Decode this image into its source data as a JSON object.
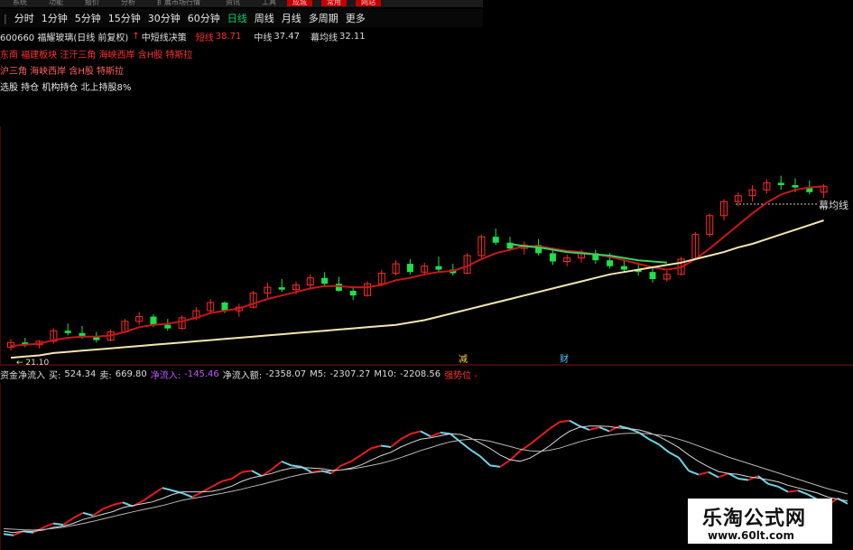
{
  "toolbar": {
    "menus": [
      "系统",
      "功能",
      "报价",
      "分析",
      "扩展市场行情",
      "资讯",
      "工具",
      "帮助"
    ],
    "red_menus": [
      "成城",
      "常用",
      "网站"
    ]
  },
  "periods": [
    "分时",
    "1分钟",
    "5分钟",
    "15分钟",
    "30分钟",
    "60分钟",
    "日线",
    "周线",
    "月线",
    "多周期",
    "更多"
  ],
  "active_period": "日线",
  "info": {
    "stock": "600660 福耀玻璃(日线 前复权)",
    "indicator": "中短线决策",
    "short_label": "短线",
    "short_value": "38.71",
    "mid_label": "中线",
    "mid_value": "37.47",
    "long_label": "幕均线",
    "long_value": "32.11"
  },
  "tags": {
    "line1": "东南 福建板块 汪汗三角 海峡西岸 含H股 特斯拉",
    "line2": "沪三角 海峡西岸 含H股 特斯拉",
    "line3": "选股 持仓 机构持仓 北上持股8%"
  },
  "ma_label": "幕均线",
  "markers": {
    "low_price": "21.10",
    "event1": "减",
    "event2": "财"
  },
  "volume_bar": {
    "title": "资金净流入",
    "buy_label": "买:",
    "buy_value": "524.34",
    "sell_label": "卖:",
    "sell_value": "669.80",
    "net_label": "净流入:",
    "net_value": "-145.46",
    "cum_label": "净流入额:",
    "cum_value": "-2358.07",
    "m5_label": "M5:",
    "m5_value": "-2307.27",
    "m10_label": "M10:",
    "m10_value": "-2208.56",
    "extra": "强势位 -"
  },
  "watermark": {
    "title": "乐淘公式网",
    "url": "www.60lt.com"
  },
  "colors": {
    "up": "#ff2a2a",
    "down": "#1fe04a",
    "flat_yellow": "#f0e060",
    "ma_short": "#c81818",
    "ma_mid": "#3ed060",
    "ma_long": "#f4e6b0",
    "flow_red": "#e81c1c",
    "flow_cyan": "#6fd4e8",
    "flow_white": "#d8d8d8"
  },
  "chart_data": [
    {
      "type": "candlestick",
      "title": "600660 福耀玻璃(日线 前复权)",
      "ylim": [
        20,
        40
      ],
      "candles": [
        [
          21.2,
          21.9,
          20.9,
          21.6
        ],
        [
          21.6,
          22.0,
          21.2,
          21.4
        ],
        [
          21.4,
          21.8,
          21.1,
          21.7
        ],
        [
          21.7,
          22.8,
          21.5,
          22.6
        ],
        [
          22.6,
          23.2,
          22.2,
          22.4
        ],
        [
          22.4,
          23.0,
          21.9,
          22.1
        ],
        [
          22.1,
          22.5,
          21.6,
          21.8
        ],
        [
          21.8,
          22.7,
          21.7,
          22.5
        ],
        [
          22.5,
          23.6,
          22.4,
          23.4
        ],
        [
          23.4,
          24.2,
          23.1,
          23.8
        ],
        [
          23.8,
          24.0,
          22.9,
          23.1
        ],
        [
          23.1,
          23.6,
          22.6,
          22.8
        ],
        [
          22.8,
          23.9,
          22.7,
          23.7
        ],
        [
          23.7,
          24.6,
          23.5,
          24.3
        ],
        [
          24.3,
          25.3,
          24.1,
          25.0
        ],
        [
          25.0,
          25.1,
          24.1,
          24.3
        ],
        [
          24.3,
          24.9,
          23.8,
          24.6
        ],
        [
          24.6,
          26.0,
          24.5,
          25.8
        ],
        [
          25.8,
          26.7,
          25.4,
          26.3
        ],
        [
          26.3,
          27.0,
          25.9,
          26.1
        ],
        [
          26.1,
          26.8,
          25.7,
          26.5
        ],
        [
          26.5,
          27.4,
          26.1,
          27.1
        ],
        [
          27.1,
          27.6,
          26.3,
          26.6
        ],
        [
          26.6,
          27.2,
          25.9,
          26.0
        ],
        [
          26.0,
          26.4,
          25.2,
          25.6
        ],
        [
          25.6,
          26.8,
          25.5,
          26.6
        ],
        [
          26.6,
          27.8,
          26.4,
          27.5
        ],
        [
          27.5,
          28.6,
          27.3,
          28.3
        ],
        [
          28.3,
          28.7,
          27.4,
          27.6
        ],
        [
          27.6,
          28.4,
          27.3,
          28.1
        ],
        [
          28.1,
          28.9,
          27.6,
          27.8
        ],
        [
          27.8,
          28.3,
          27.3,
          27.5
        ],
        [
          27.5,
          29.2,
          27.4,
          29.0
        ],
        [
          29.0,
          30.8,
          28.8,
          30.6
        ],
        [
          30.6,
          31.3,
          29.9,
          30.1
        ],
        [
          30.1,
          30.6,
          29.4,
          29.6
        ],
        [
          29.6,
          30.2,
          29.1,
          29.9
        ],
        [
          29.9,
          30.4,
          29.0,
          29.2
        ],
        [
          29.2,
          29.6,
          28.2,
          28.5
        ],
        [
          28.5,
          29.1,
          28.1,
          28.8
        ],
        [
          28.8,
          29.5,
          28.4,
          29.2
        ],
        [
          29.2,
          29.5,
          28.3,
          28.6
        ],
        [
          28.6,
          29.2,
          27.9,
          28.1
        ],
        [
          28.1,
          28.7,
          27.6,
          27.8
        ],
        [
          27.8,
          28.4,
          27.3,
          27.6
        ],
        [
          27.6,
          28.0,
          26.7,
          27.0
        ],
        [
          27.0,
          27.7,
          26.8,
          27.4
        ],
        [
          27.4,
          28.9,
          27.3,
          28.7
        ],
        [
          28.7,
          31.0,
          28.6,
          30.8
        ],
        [
          30.8,
          32.6,
          30.6,
          32.4
        ],
        [
          32.4,
          33.8,
          32.0,
          33.6
        ],
        [
          33.6,
          34.4,
          33.2,
          34.1
        ],
        [
          34.1,
          35.0,
          33.6,
          34.6
        ],
        [
          34.6,
          35.5,
          34.3,
          35.2
        ],
        [
          35.2,
          35.8,
          34.6,
          35.0
        ],
        [
          35.0,
          35.6,
          34.4,
          34.8
        ],
        [
          34.8,
          35.4,
          34.2,
          34.4
        ],
        [
          34.4,
          35.1,
          33.9,
          34.9
        ]
      ],
      "series": [
        {
          "name": "短线",
          "values": [
            21.3,
            21.4,
            21.5,
            21.8,
            22.0,
            22.1,
            22.1,
            22.2,
            22.5,
            22.9,
            23.1,
            23.2,
            23.4,
            23.7,
            24.1,
            24.3,
            24.5,
            24.9,
            25.3,
            25.6,
            25.9,
            26.2,
            26.4,
            26.4,
            26.3,
            26.3,
            26.5,
            26.9,
            27.1,
            27.4,
            27.6,
            27.7,
            28.1,
            28.7,
            29.2,
            29.5,
            29.8,
            29.8,
            29.6,
            29.4,
            29.3,
            29.1,
            28.9,
            28.6,
            28.3,
            28.0,
            27.8,
            28.0,
            28.7,
            29.6,
            30.6,
            31.6,
            32.6,
            33.5,
            34.2,
            34.6,
            34.8,
            34.9
          ]
        },
        {
          "name": "中线",
          "values": [
            null,
            null,
            null,
            null,
            null,
            null,
            null,
            null,
            null,
            null,
            null,
            null,
            null,
            null,
            null,
            null,
            null,
            null,
            null,
            null,
            null,
            null,
            null,
            null,
            null,
            null,
            null,
            null,
            null,
            null,
            null,
            null,
            null,
            null,
            null,
            30.0,
            29.8,
            29.7,
            29.5,
            29.3,
            29.2,
            29.1,
            29.0,
            28.8,
            28.6,
            28.5,
            28.4,
            null,
            null,
            null,
            null,
            null,
            null,
            null,
            null,
            null,
            null,
            null
          ]
        },
        {
          "name": "幕均线",
          "values": [
            20.3,
            20.4,
            20.5,
            20.7,
            20.8,
            20.9,
            21.0,
            21.1,
            21.2,
            21.3,
            21.4,
            21.5,
            21.6,
            21.7,
            21.8,
            21.9,
            22.0,
            22.1,
            22.2,
            22.3,
            22.4,
            22.5,
            22.6,
            22.7,
            22.8,
            22.9,
            23.0,
            23.1,
            23.3,
            23.5,
            23.8,
            24.1,
            24.4,
            24.7,
            25.0,
            25.3,
            25.6,
            25.9,
            26.2,
            26.5,
            26.8,
            27.1,
            27.4,
            27.6,
            27.8,
            28.0,
            28.2,
            28.4,
            28.7,
            29.0,
            29.3,
            29.7,
            30.0,
            30.4,
            30.8,
            31.2,
            31.6,
            32.0
          ]
        }
      ]
    },
    {
      "type": "line",
      "title": "资金净流入",
      "ylim": [
        -3000,
        3000
      ],
      "series": [
        {
          "name": "净流入额",
          "values": [
            -2700,
            -2750,
            -2600,
            -2650,
            -2450,
            -2300,
            -2350,
            -2100,
            -1900,
            -2000,
            -1750,
            -1600,
            -1500,
            -1650,
            -1450,
            -1200,
            -950,
            -1050,
            -1150,
            -1300,
            -1100,
            -900,
            -700,
            -600,
            -350,
            -300,
            -500,
            -250,
            50,
            -100,
            -150,
            -350,
            -300,
            -400,
            -100,
            50,
            300,
            550,
            650,
            600,
            900,
            1100,
            1200,
            1000,
            1150,
            1100,
            800,
            500,
            250,
            -100,
            -150,
            100,
            450,
            700,
            1000,
            1300,
            1550,
            1600,
            1400,
            1250,
            1350,
            1200,
            1400,
            1300,
            1150,
            900,
            700,
            400,
            200,
            -300,
            -450,
            -350,
            -550,
            -400,
            -600,
            -650,
            -500,
            -800,
            -900,
            -1100,
            -1050,
            -1200,
            -1400,
            -1600,
            -1350,
            -1550
          ]
        },
        {
          "name": "M5",
          "values": [
            -2600,
            -2650,
            -2600,
            -2600,
            -2550,
            -2450,
            -2400,
            -2300,
            -2150,
            -2050,
            -1950,
            -1850,
            -1700,
            -1620,
            -1550,
            -1480,
            -1350,
            -1200,
            -1100,
            -1100,
            -1100,
            -1080,
            -1000,
            -880,
            -700,
            -570,
            -490,
            -400,
            -280,
            -200,
            -180,
            -200,
            -220,
            -280,
            -270,
            -200,
            -80,
            100,
            270,
            400,
            600,
            760,
            900,
            950,
            1030,
            1100,
            1080,
            950,
            750,
            550,
            300,
            120,
            60,
            180,
            400,
            650,
            950,
            1200,
            1350,
            1400,
            1400,
            1380,
            1320,
            1300,
            1250,
            1150,
            1000,
            800,
            580,
            300,
            50,
            -150,
            -330,
            -400,
            -440,
            -520,
            -580,
            -640,
            -720,
            -850,
            -950,
            -1050,
            -1150,
            -1300,
            -1380,
            -1450
          ]
        },
        {
          "name": "M10",
          "values": [
            -2500,
            -2520,
            -2540,
            -2550,
            -2530,
            -2490,
            -2440,
            -2380,
            -2300,
            -2220,
            -2130,
            -2040,
            -1950,
            -1860,
            -1780,
            -1700,
            -1620,
            -1520,
            -1420,
            -1350,
            -1290,
            -1220,
            -1160,
            -1080,
            -1000,
            -900,
            -820,
            -720,
            -620,
            -520,
            -440,
            -380,
            -330,
            -300,
            -270,
            -230,
            -170,
            -100,
            -20,
            80,
            200,
            330,
            470,
            580,
            700,
            800,
            860,
            900,
            880,
            820,
            720,
            620,
            520,
            460,
            440,
            480,
            560,
            680,
            800,
            900,
            980,
            1050,
            1100,
            1120,
            1120,
            1100,
            1060,
            1000,
            900,
            780,
            640,
            500,
            360,
            220,
            100,
            -20,
            -140,
            -260,
            -380,
            -500,
            -620,
            -740,
            -860,
            -980,
            -1080,
            -1180
          ]
        }
      ]
    }
  ]
}
